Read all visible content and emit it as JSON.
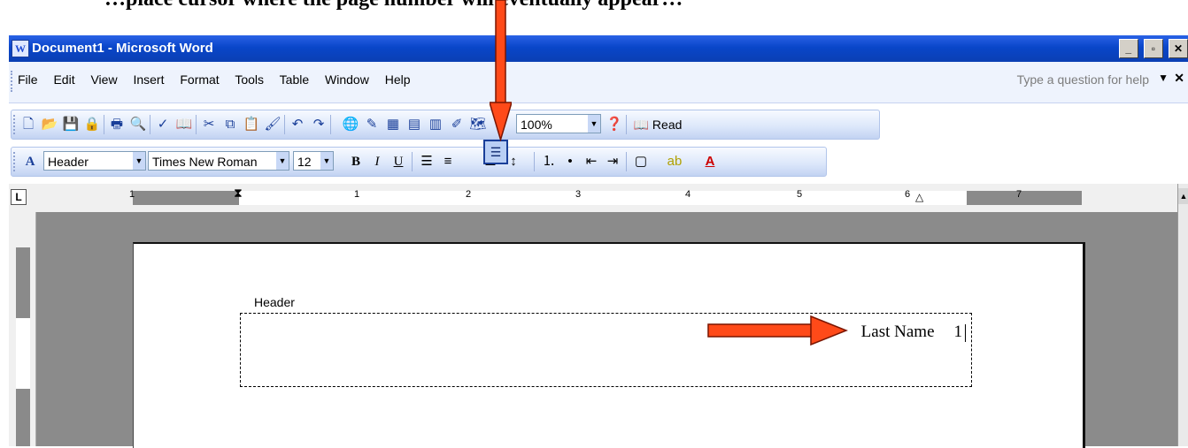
{
  "caption": "…place cursor where the page number will eventually appear…",
  "window": {
    "title": "Document1 - Microsoft Word",
    "min_label": "_",
    "max_label": "▫",
    "close_label": "✕"
  },
  "menu": {
    "items": [
      "File",
      "Edit",
      "View",
      "Insert",
      "Format",
      "Tools",
      "Table",
      "Window",
      "Help"
    ],
    "help_placeholder": "Type a question for help"
  },
  "standard_toolbar": {
    "zoom": "100%",
    "read_label": "Read"
  },
  "formatting_toolbar": {
    "style": "Header",
    "font": "Times New Roman",
    "size": "12"
  },
  "ruler": {
    "numbers": [
      "1",
      "1",
      "2",
      "3",
      "4",
      "5",
      "6",
      "7"
    ]
  },
  "document": {
    "header_label": "Header",
    "header_text": "Last Name",
    "page_number": "1"
  },
  "colors": {
    "annotation_arrow": "#ff4a19",
    "title_bar": "#0a46c8"
  },
  "icons": {
    "align_right": "align-right-icon",
    "align_left": "align-left-icon",
    "align_center": "align-center-icon",
    "justify": "justify-icon"
  }
}
